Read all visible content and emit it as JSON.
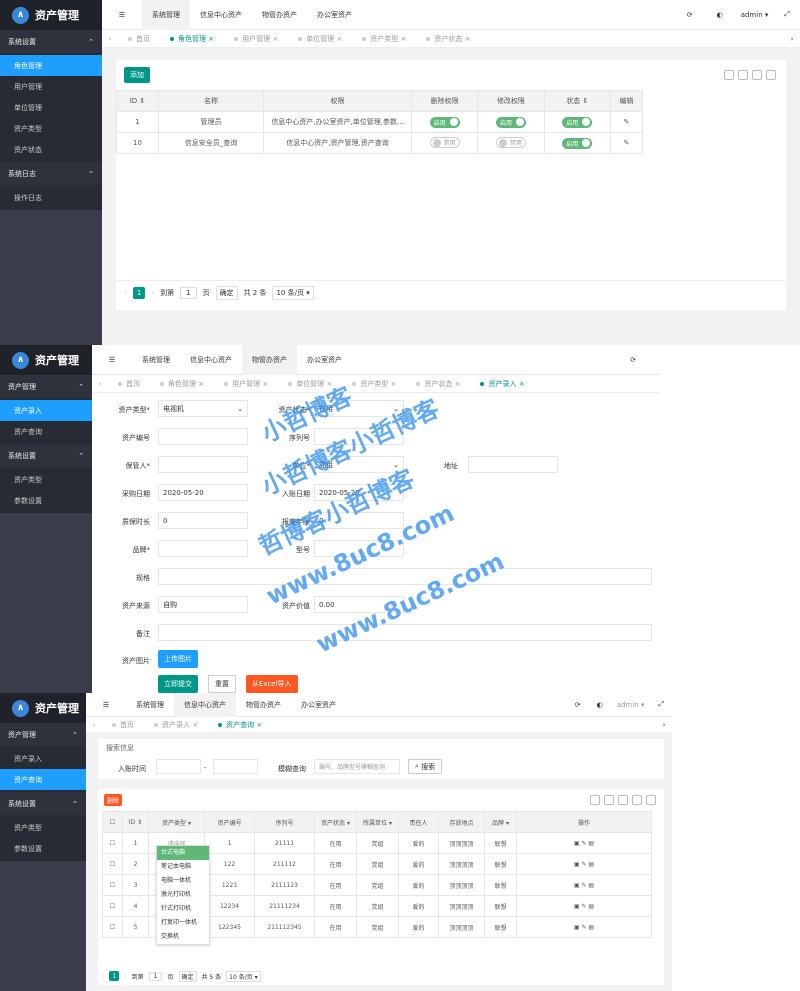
{
  "app_title": "资产管理",
  "user": "admin",
  "panel1": {
    "sidebar": {
      "group1": "系统设置",
      "items": [
        "角色管理",
        "用户管理",
        "单位管理",
        "资产类型",
        "资产状态"
      ],
      "group2": "系统日志",
      "log_item": "操作日志"
    },
    "top_tabs": [
      "系统管理",
      "信息中心资产",
      "物管办资产",
      "办公室资产"
    ],
    "page_tabs": [
      "首页",
      "角色管理",
      "用户管理",
      "单位管理",
      "资产类型",
      "资产状态"
    ],
    "add_button": "添加",
    "columns": [
      "ID",
      "名称",
      "权限",
      "删除权限",
      "修改权限",
      "状态",
      "编辑"
    ],
    "rows": [
      {
        "id": "1",
        "name": "管理员",
        "perm": "信息中心资产,办公室资产,单位管理,参数...",
        "del": "启用",
        "mod": "启用",
        "status": "启用"
      },
      {
        "id": "10",
        "name": "信息安全员_查询",
        "perm": "信息中心资产,资产管理,资产查询",
        "del": "禁用",
        "mod": "禁用",
        "status": "启用"
      }
    ],
    "pager": {
      "page": "1",
      "goto": "到第",
      "page_input": "1",
      "page_unit": "页",
      "confirm": "确定",
      "total": "共 2 条",
      "per_page": "10 条/页"
    }
  },
  "panel2": {
    "sidebar": {
      "group1": "资产管理",
      "items": [
        "资产录入",
        "资产查询"
      ],
      "group2": "系统设置",
      "items2": [
        "资产类型",
        "参数设置"
      ]
    },
    "top_tabs": [
      "系统管理",
      "信息中心资产",
      "物管办资产",
      "办公室资产"
    ],
    "page_tabs": [
      "首页",
      "角色管理",
      "用户管理",
      "单位管理",
      "资产类型",
      "资产状态",
      "资产录入"
    ],
    "form": {
      "type_label": "资产类型*",
      "type_value": "电视机",
      "status_label": "资产状态*",
      "status_value": "在用",
      "code_label": "资产编号",
      "serial_label": "序列号",
      "keeper_label": "保管人*",
      "unit_label": "单位*",
      "unit_value": "党组",
      "location_label": "地址",
      "buy_date_label": "采购日期",
      "buy_date_value": "2020-05-20",
      "entry_date_label": "入账日期",
      "entry_date_value": "2020-05-20",
      "warranty_label": "质保时长",
      "warranty_value": "0",
      "scrap_label": "报废年限",
      "scrap_value": "0",
      "brand_label": "品牌*",
      "model_label": "型号",
      "spec_label": "规格",
      "source_label": "资产来源",
      "source_value": "自购",
      "price_label": "资产价值",
      "price_value": "0.00",
      "note_label": "备注",
      "image_label": "资产图片",
      "upload_button": "上传图片",
      "submit_button": "立即提交",
      "reset_button": "重置",
      "excel_button": "从Excel导入"
    },
    "watermark": [
      "小哲博客",
      "小哲博客小哲博客",
      "哲博客小哲博客",
      "www.8uc8.com",
      "www.8uc8.com"
    ]
  },
  "panel3": {
    "sidebar": {
      "group1": "资产管理",
      "items": [
        "资产录入",
        "资产查询"
      ],
      "group2": "系统设置",
      "items2": [
        "资产类型",
        "参数设置"
      ]
    },
    "top_tabs": [
      "系统管理",
      "信息中心资产",
      "物管办资产",
      "办公室资产"
    ],
    "page_tabs": [
      "首页",
      "资产录入",
      "资产查询"
    ],
    "search": {
      "title": "搜索信息",
      "date_label": "入账时间",
      "dash": "-",
      "fuzzy_label": "模糊查询",
      "fuzzy_placeholder": "编号、品牌型号模糊查询",
      "search_button": "搜索"
    },
    "delete_button": "删除",
    "columns": [
      "ID",
      "资产类型",
      "资产编号",
      "序列号",
      "资产状态",
      "所属单位",
      "责任人",
      "存放地点",
      "品牌",
      "操作"
    ],
    "rows": [
      {
        "id": "1",
        "type": "",
        "code": "1",
        "serial": "21111",
        "status": "在用",
        "unit": "党组",
        "owner": "爱的",
        "place": "顶顶顶顶",
        "brand": "联想"
      },
      {
        "id": "2",
        "type": "",
        "code": "122",
        "serial": "211112",
        "status": "在用",
        "unit": "党组",
        "owner": "爱的",
        "place": "顶顶顶顶",
        "brand": "联想"
      },
      {
        "id": "3",
        "type": "",
        "code": "1223",
        "serial": "2111123",
        "status": "在用",
        "unit": "党组",
        "owner": "爱的",
        "place": "顶顶顶顶",
        "brand": "联想"
      },
      {
        "id": "4",
        "type": "",
        "code": "12234",
        "serial": "21111234",
        "status": "在用",
        "unit": "党组",
        "owner": "爱的",
        "place": "顶顶顶顶",
        "brand": "联想"
      },
      {
        "id": "5",
        "type": "",
        "code": "122345",
        "serial": "211112345",
        "status": "在用",
        "unit": "党组",
        "owner": "爱的",
        "place": "顶顶顶顶",
        "brand": "联想"
      }
    ],
    "dropdown": {
      "placeholder": "请选择",
      "options": [
        "台式电脑",
        "笔记本电脑",
        "电脑一体机",
        "激光打印机",
        "针式打印机",
        "打复印一体机",
        "交换机"
      ]
    },
    "pager": {
      "page": "1",
      "goto": "到第",
      "page_input": "1",
      "page_unit": "页",
      "confirm": "确定",
      "total": "共 5 条",
      "per_page": "10 条/页"
    }
  }
}
